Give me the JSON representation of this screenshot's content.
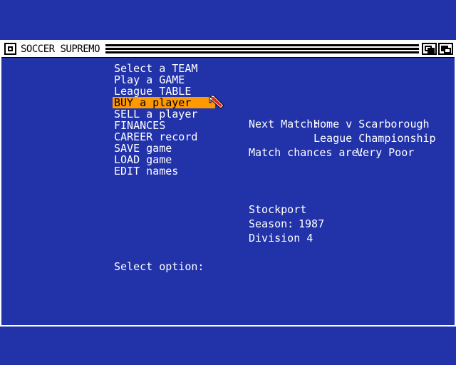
{
  "window": {
    "title": "SOCCER SUPREMO"
  },
  "menu": {
    "items": [
      {
        "label": "Select a TEAM",
        "highlighted": false
      },
      {
        "label": "Play a GAME",
        "highlighted": false
      },
      {
        "label": "League TABLE",
        "highlighted": false
      },
      {
        "label": "BUY a player",
        "highlighted": true
      },
      {
        "label": "SELL a player",
        "highlighted": false
      },
      {
        "label": "FINANCES",
        "highlighted": false
      },
      {
        "label": "CAREER record",
        "highlighted": false
      },
      {
        "label": "SAVE game",
        "highlighted": false
      },
      {
        "label": "LOAD game",
        "highlighted": false
      },
      {
        "label": "EDIT names",
        "highlighted": false
      }
    ],
    "highlight_color": "#ff9900"
  },
  "match": {
    "next_label": "Next Match:",
    "next_value": "Home v Scarborough",
    "competition": "League Championship",
    "chances_label": "Match chances are:",
    "chances_value": "Very Poor"
  },
  "club": {
    "name": "Stockport",
    "season_label": "Season:",
    "season_value": "1987",
    "division": "Division 4"
  },
  "prompt": "Select option:",
  "colors": {
    "background": "#2233aa",
    "text": "#ffffff",
    "titlebar": "#ffffff"
  },
  "icons": {
    "cursor": "pointer-arrow-icon",
    "close": "close-gadget-icon",
    "depth_back": "depth-back-icon",
    "depth_front": "depth-front-icon"
  }
}
